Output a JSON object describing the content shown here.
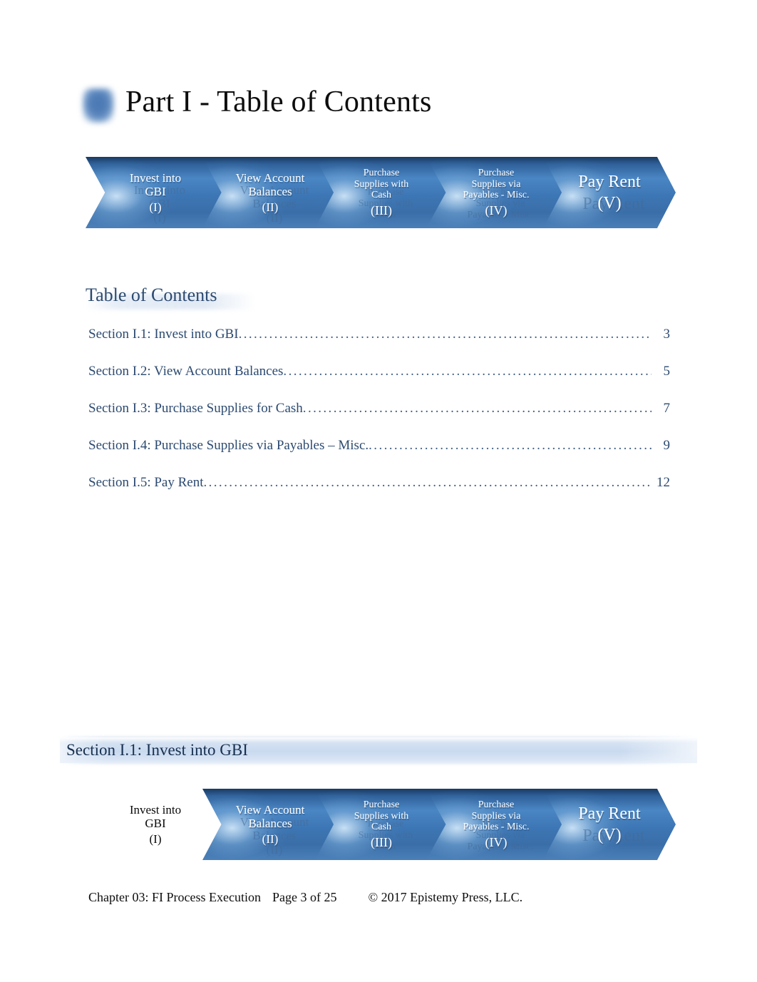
{
  "document": {
    "title": "Part I - Table of Contents"
  },
  "decor": {
    "square_icon": "blue-rounded-square-icon"
  },
  "process_flow_top": {
    "steps": [
      {
        "label": "Invest into\nGBI",
        "line1": "Invest into",
        "line2": "GBI",
        "roman": "(I)",
        "active": false
      },
      {
        "label": "View Account\nBalances",
        "line1": "View Account",
        "line2": "Balances",
        "roman": "(II)",
        "active": false
      },
      {
        "label": "Purchase\nSupplies with\nCash",
        "line1": "Purchase",
        "line2": "Supplies with",
        "line3": "Cash",
        "roman": "(III)",
        "active": false
      },
      {
        "label": "Purchase\nSupplies via\nPayables - Misc.",
        "line1": "Purchase",
        "line2": "Supplies via",
        "line3": "Payables - Misc.",
        "roman": "(IV)",
        "active": false
      },
      {
        "label": "Pay Rent",
        "line1": "Pay Rent",
        "roman": "(V)",
        "active": false
      }
    ]
  },
  "toc": {
    "heading": "Table of Contents",
    "entries": [
      {
        "label": "Section I.1: Invest into GBI",
        "page": "3"
      },
      {
        "label": "Section I.2: View Account Balances",
        "page": "5"
      },
      {
        "label": "Section I.3: Purchase Supplies for Cash",
        "page": "7"
      },
      {
        "label": "Section I.4: Purchase Supplies via Payables – Misc.",
        "page": "9"
      },
      {
        "label": "Section I.5: Pay Rent",
        "page": "12"
      }
    ],
    "leader": "................................................................................................................................................................"
  },
  "section": {
    "heading": "Section I.1: Invest into GBI"
  },
  "process_flow_bottom": {
    "steps": [
      {
        "label": "Invest into\nGBI",
        "line1": "Invest into",
        "line2": "GBI",
        "roman": "(I)",
        "active": true
      },
      {
        "label": "View Account\nBalances",
        "line1": "View Account",
        "line2": "Balances",
        "roman": "(II)",
        "active": false
      },
      {
        "label": "Purchase\nSupplies with\nCash",
        "line1": "Purchase",
        "line2": "Supplies with",
        "line3": "Cash",
        "roman": "(III)",
        "active": false
      },
      {
        "label": "Purchase\nSupplies via\nPayables - Misc.",
        "line1": "Purchase",
        "line2": "Supplies via",
        "line3": "Payables - Misc.",
        "roman": "(IV)",
        "active": false
      },
      {
        "label": "Pay Rent",
        "line1": "Pay Rent",
        "roman": "(V)",
        "active": false
      }
    ]
  },
  "footer": {
    "chapter": "Chapter 03: FI Process Execution",
    "page": "Page 3 of 25",
    "copyright": "© 2017 Epistemy Press, LLC."
  },
  "colors": {
    "chevron_dark": "#183a62",
    "chevron_mid": "#4a86c4",
    "heading_navy": "#2c4a70",
    "section_bar": "#c7d8ee",
    "body_text": "#0d0d0d"
  }
}
